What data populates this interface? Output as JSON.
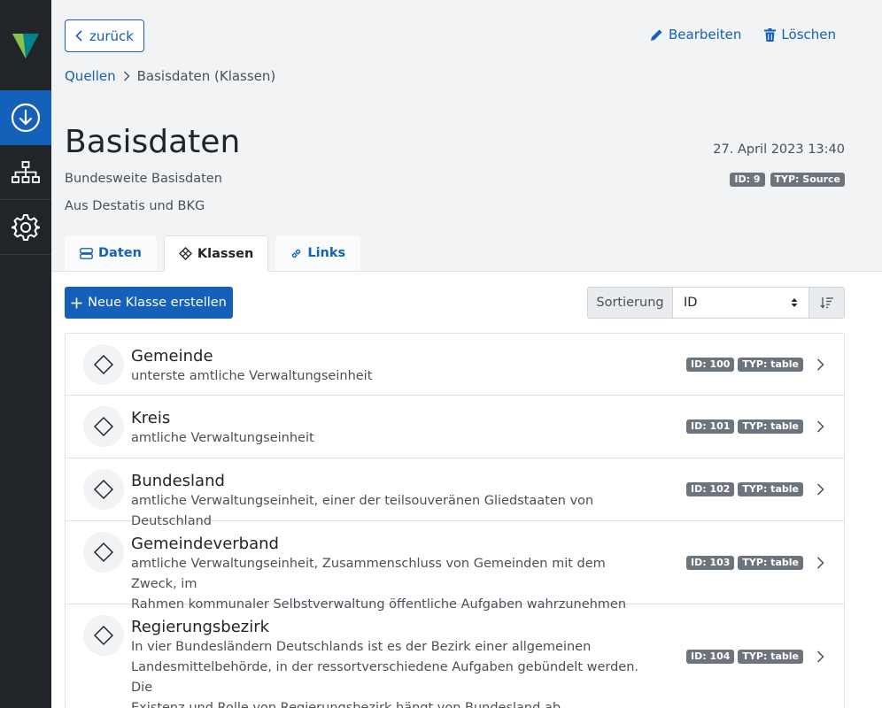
{
  "sidebar": {
    "items": [
      {
        "icon": "download-icon",
        "active": true
      },
      {
        "icon": "sitemap-icon",
        "active": false
      },
      {
        "icon": "gear-icon",
        "active": false
      }
    ]
  },
  "header": {
    "back_label": "zurück",
    "edit_label": "Bearbeiten",
    "delete_label": "Löschen",
    "breadcrumb": {
      "root": "Quellen",
      "current": "Basisdaten (Klassen)"
    },
    "title": "Basisdaten",
    "subtitle": "Bundesweite Basisdaten",
    "source": "Aus Destatis und BKG",
    "date": "27. April 2023 13:40",
    "badges": {
      "id": "ID: 9",
      "type": "TYP: Source"
    }
  },
  "tabs": [
    {
      "label": "Daten",
      "icon": "database-icon",
      "active": false
    },
    {
      "label": "Klassen",
      "icon": "class-icon",
      "active": true
    },
    {
      "label": "Links",
      "icon": "link-icon",
      "active": false
    }
  ],
  "toolbar": {
    "new_class_label": "Neue Klasse erstellen",
    "sort_label": "Sortierung",
    "sort_value": "ID"
  },
  "classes": [
    {
      "name": "Gemeinde",
      "desc": [
        "unterste amtliche Verwaltungseinheit"
      ],
      "id": "ID: 100",
      "type": "TYP: table"
    },
    {
      "name": "Kreis",
      "desc": [
        "amtliche Verwaltungseinheit"
      ],
      "id": "ID: 101",
      "type": "TYP: table"
    },
    {
      "name": "Bundesland",
      "desc": [
        "amtliche Verwaltungseinheit, einer der teilsouveränen Gliedstaaten von Deutschland"
      ],
      "id": "ID: 102",
      "type": "TYP: table"
    },
    {
      "name": "Gemeindeverband",
      "desc": [
        "amtliche Verwaltungseinheit, Zusammenschluss von Gemeinden mit dem Zweck, im",
        "Rahmen kommunaler Selbstverwaltung öffentliche Aufgaben wahrzunehmen"
      ],
      "id": "ID: 103",
      "type": "TYP: table"
    },
    {
      "name": "Regierungsbezirk",
      "desc": [
        "In vier Bundesländern Deutschlands ist es der Bezirk einer allgemeinen",
        "Landesmittelbehörde, in der ressortverschiedene Aufgaben gebündelt werden. Die",
        "Existenz und Rolle von Regierungsbezirk hängt von Bundesland ab."
      ],
      "id": "ID: 104",
      "type": "TYP: table"
    }
  ],
  "colors": {
    "primary": "#1560b8",
    "sidebar": "#212529",
    "badge": "#6c757d",
    "logo_green": "#4caf50",
    "logo_teal": "#00838f"
  }
}
